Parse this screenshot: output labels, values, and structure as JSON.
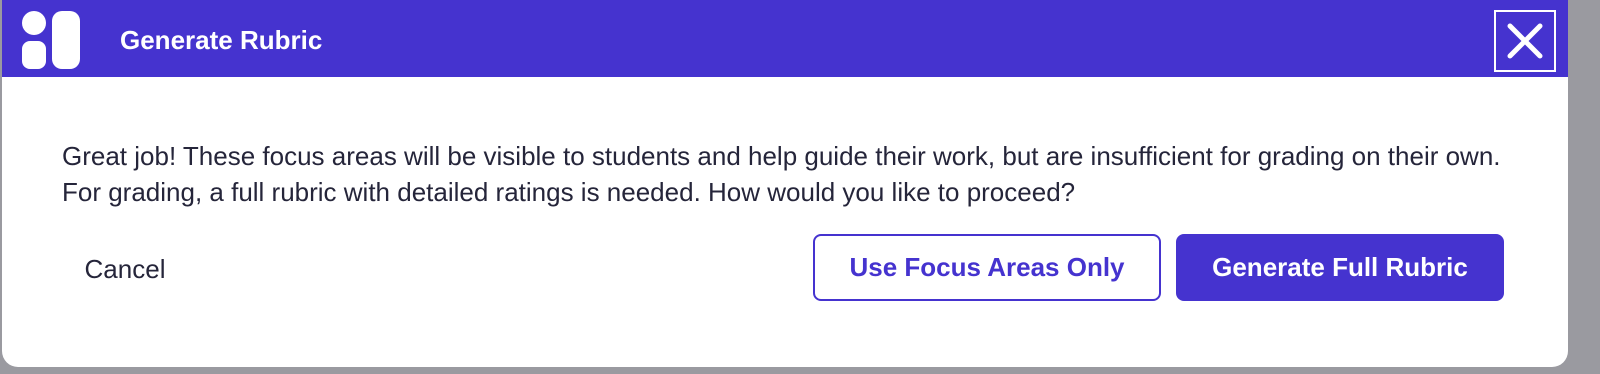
{
  "dialog": {
    "title": "Generate Rubric",
    "logo_icon": "app-logo-icon",
    "close_icon": "close-icon",
    "message": "Great job! These focus areas will be visible to students and help guide their work, but are insufficient for grading on their own. For grading, a full rubric with detailed ratings is needed. How would you like to proceed?",
    "cancel_label": "Cancel",
    "focus_areas_label": "Use Focus Areas Only",
    "full_rubric_label": "Generate Full Rubric"
  },
  "colors": {
    "brand": "#4533cf",
    "text": "#25253a",
    "background": "#ffffff"
  }
}
